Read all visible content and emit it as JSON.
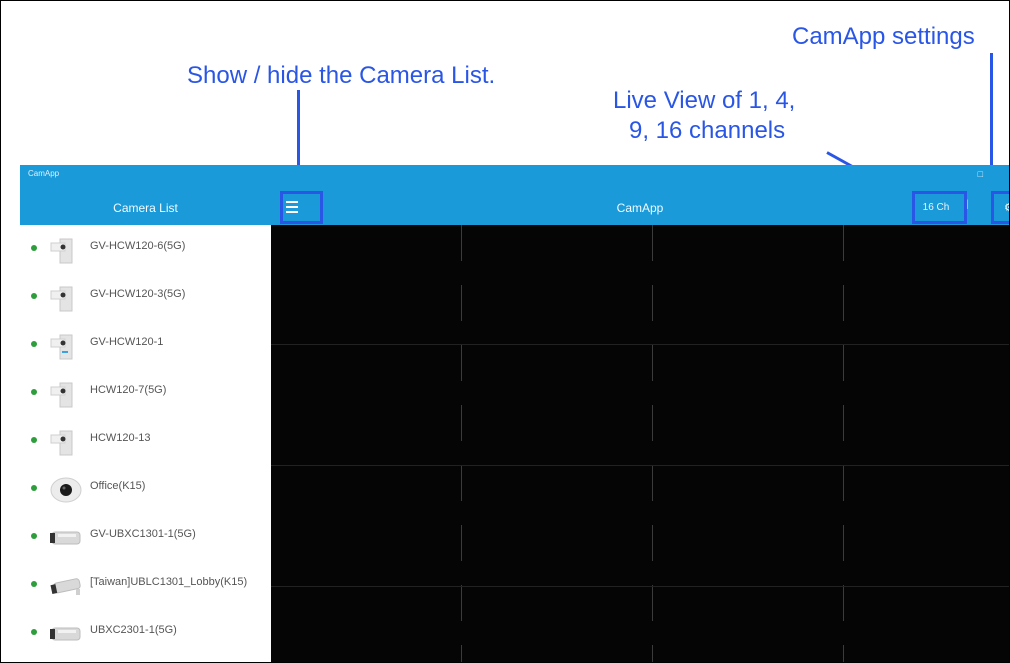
{
  "annotations": {
    "camera_list_toggle": "Show / hide the Camera List.",
    "live_view_line1": "Live View of 1, 4,",
    "live_view_line2": "9, 16 channels",
    "settings": "CamApp settings"
  },
  "window": {
    "title": "CamApp"
  },
  "header": {
    "camera_list_title": "Camera List",
    "app_title": "CamApp",
    "channel_button": "16 Ch",
    "separator": "|"
  },
  "cameras": [
    {
      "name": "GV-HCW120-6(5G)",
      "icon": "box-camera-icon",
      "status": "online"
    },
    {
      "name": "GV-HCW120-3(5G)",
      "icon": "box-camera-icon",
      "status": "online"
    },
    {
      "name": "GV-HCW120-1",
      "icon": "box-camera-icon",
      "status": "online"
    },
    {
      "name": "HCW120-7(5G)",
      "icon": "box-camera-icon",
      "status": "online"
    },
    {
      "name": "HCW120-13",
      "icon": "box-camera-icon",
      "status": "online"
    },
    {
      "name": "Office(K15)",
      "icon": "dome-camera-icon",
      "status": "online"
    },
    {
      "name": "GV-UBXC1301-1(5G)",
      "icon": "bullet-camera-icon",
      "status": "online"
    },
    {
      "name": "[Taiwan]UBLC1301_Lobby(K15)",
      "icon": "bullet-camera-icon",
      "status": "online"
    },
    {
      "name": "UBXC2301-1(5G)",
      "icon": "bullet-camera-icon",
      "status": "online"
    }
  ],
  "colors": {
    "accent": "#1a9ad9",
    "annotation": "#2a56e6",
    "online": "#2e9e3d",
    "live_view_bg": "#050505"
  }
}
